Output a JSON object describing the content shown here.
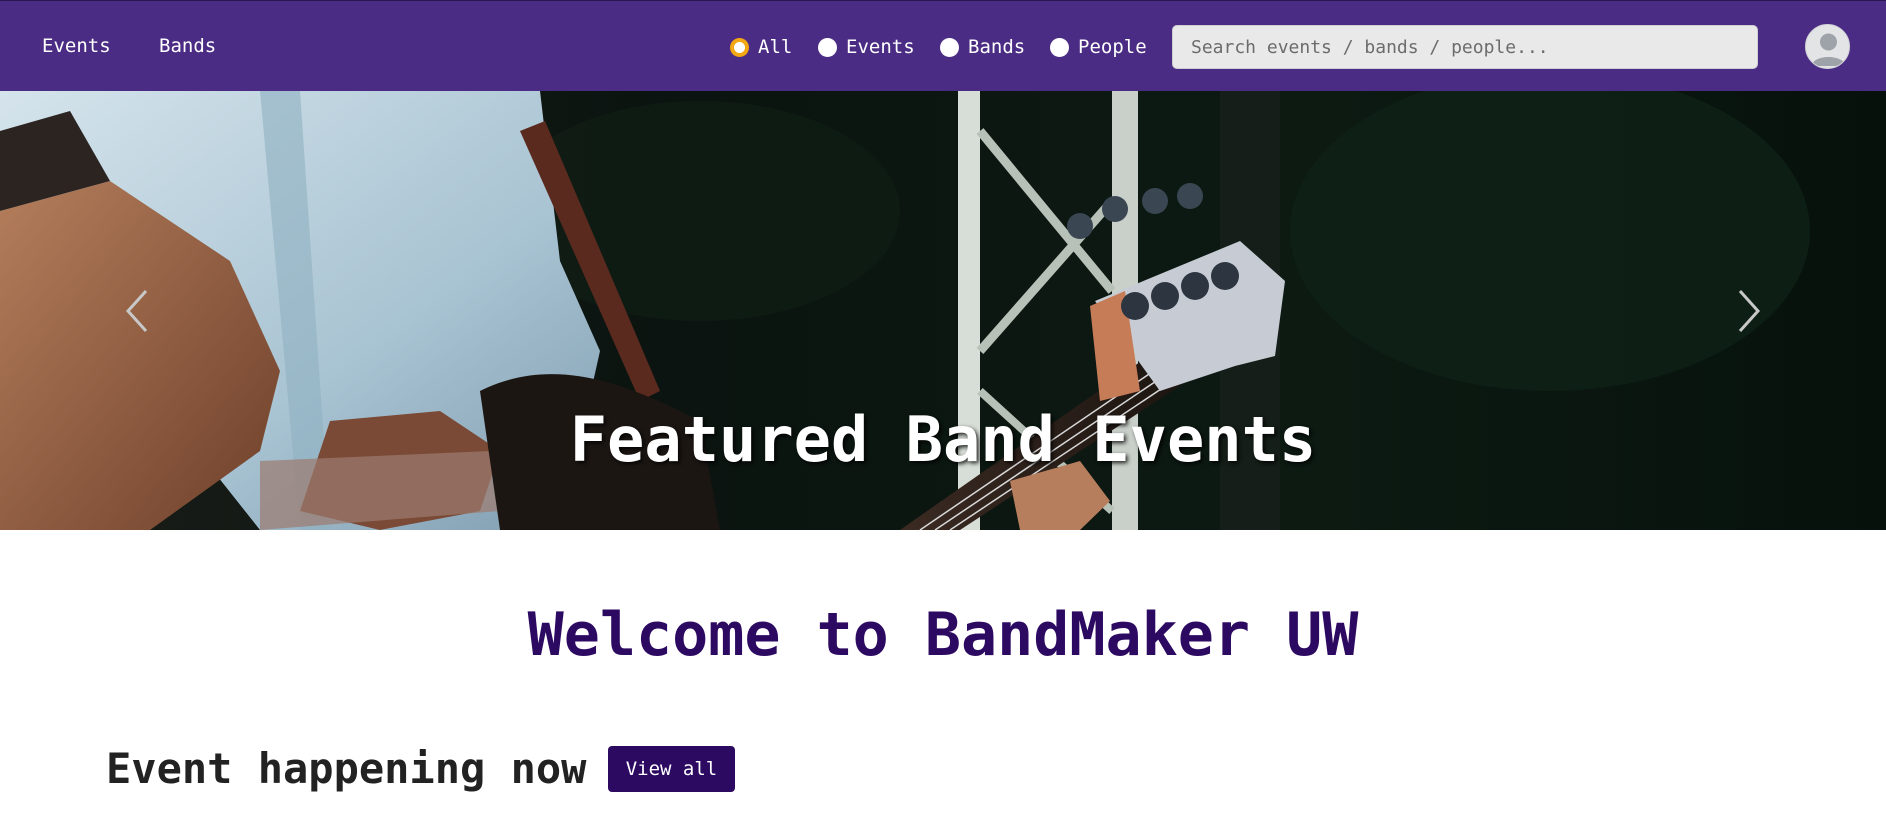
{
  "nav": {
    "links": [
      {
        "label": "Events"
      },
      {
        "label": "Bands"
      }
    ],
    "filters": [
      {
        "label": "All",
        "checked": true
      },
      {
        "label": "Events",
        "checked": false
      },
      {
        "label": "Bands",
        "checked": false
      },
      {
        "label": "People",
        "checked": false
      }
    ],
    "search": {
      "placeholder": "Search events / bands / people...",
      "value": ""
    },
    "avatar_icon": "user-avatar-icon"
  },
  "hero": {
    "caption": "Featured Band Events",
    "prev_icon": "chevron-left-icon",
    "next_icon": "chevron-right-icon"
  },
  "main": {
    "welcome": "Welcome to BandMaker UW",
    "section_title": "Event happening now",
    "view_all_label": "View all"
  },
  "colors": {
    "navbar": "#4b2c84",
    "accent": "#2d0a62",
    "radio_checked": "#f3a712"
  }
}
